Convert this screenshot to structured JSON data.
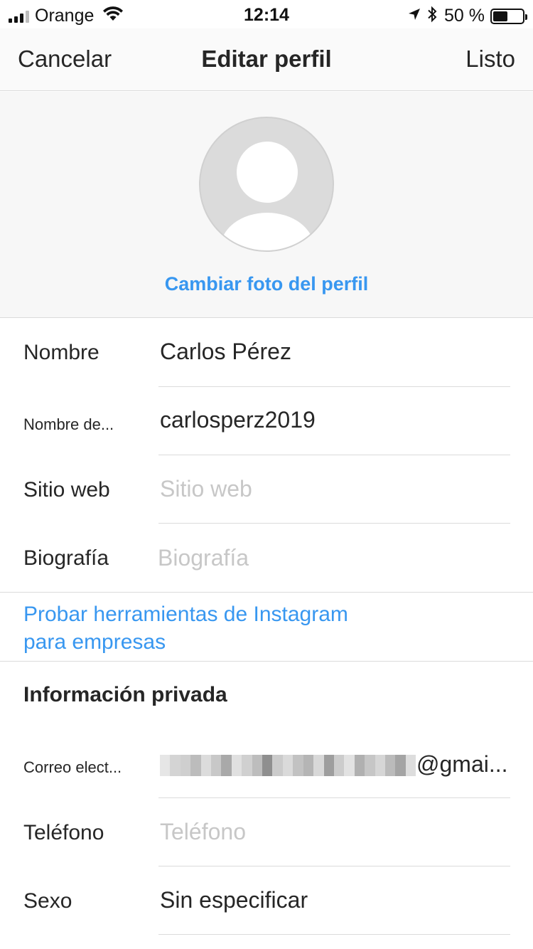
{
  "status_bar": {
    "carrier": "Orange",
    "time": "12:14",
    "battery_percent": "50 %",
    "battery_level": 0.5,
    "icons": [
      "signal-icon",
      "wifi-icon",
      "location-arrow-icon",
      "bluetooth-icon",
      "battery-icon"
    ]
  },
  "nav": {
    "cancel_label": "Cancelar",
    "title": "Editar perfil",
    "done_label": "Listo"
  },
  "photo": {
    "change_label": "Cambiar foto del perfil"
  },
  "profile_fields": {
    "name": {
      "label": "Nombre",
      "value": "Carlos Pérez"
    },
    "username": {
      "label": "Nombre de...",
      "value": "carlosperz2019"
    },
    "website": {
      "label": "Sitio web",
      "placeholder": "Sitio web"
    },
    "bio": {
      "label": "Biografía",
      "placeholder": "Biografía"
    }
  },
  "business_link": {
    "line1": "Probar herramientas de Instagram",
    "line2": "para empresas"
  },
  "private_info": {
    "title": "Información privada",
    "email": {
      "label": "Correo elect...",
      "visible_suffix": "@gmai..."
    },
    "phone": {
      "label": "Teléfono",
      "placeholder": "Teléfono"
    },
    "gender": {
      "label": "Sexo",
      "value": "Sin especificar"
    }
  },
  "colors": {
    "accent_blue": "#3897f0",
    "text": "#262626",
    "placeholder": "#c7c7c7",
    "divider": "#dbdbdb",
    "section_bg": "#f7f7f7"
  }
}
